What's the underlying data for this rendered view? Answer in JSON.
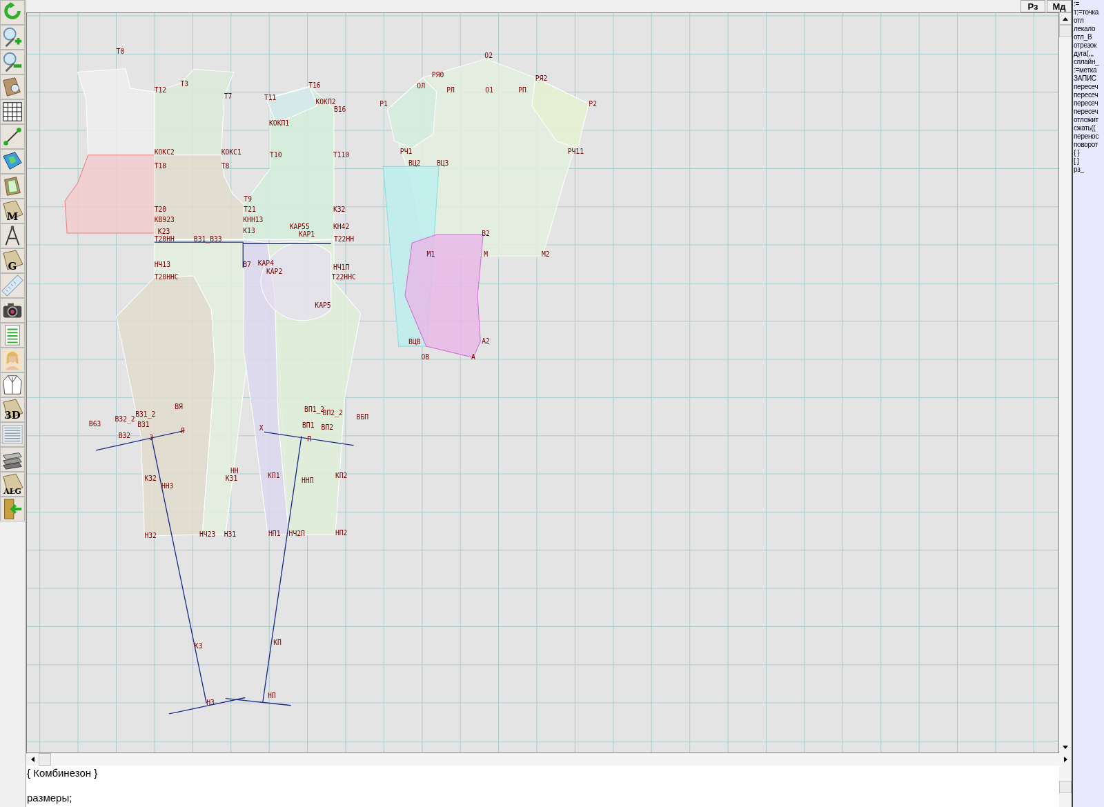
{
  "toolbar": [
    {
      "kind": "refresh"
    },
    {
      "kind": "zoom_in"
    },
    {
      "kind": "zoom_out"
    },
    {
      "kind": "pattern_view"
    },
    {
      "kind": "grid"
    },
    {
      "kind": "segment"
    },
    {
      "kind": "map"
    },
    {
      "kind": "pattern"
    },
    {
      "kind": "lettered",
      "label": "M"
    },
    {
      "kind": "compass"
    },
    {
      "kind": "lettered",
      "label": "G"
    },
    {
      "kind": "ruler"
    },
    {
      "kind": "camera"
    },
    {
      "kind": "sheet"
    },
    {
      "kind": "portrait"
    },
    {
      "kind": "jacket"
    },
    {
      "kind": "lettered",
      "label": "3D"
    },
    {
      "kind": "list"
    },
    {
      "kind": "books"
    },
    {
      "kind": "lettered",
      "label": "ALG"
    },
    {
      "kind": "exit"
    }
  ],
  "top_buttons": [
    "Рз",
    "Мд"
  ],
  "point_labels": [
    "Т0",
    "Т3",
    "Т12",
    "Т7",
    "Т11",
    "Т16",
    "КОКП2",
    "В16",
    "КОКП1",
    "КОКС2",
    "КОКС1",
    "Т10",
    "Т110",
    "Т18",
    "Т8",
    "Т9",
    "Т20",
    "Т21",
    "К32",
    "КВ923",
    "КНН13",
    "КАР55",
    "КН42",
    "К23",
    "К13",
    "КАР1",
    "Т20НН",
    "В31_В33",
    "Т22НН",
    "В7",
    "КАР4",
    "КАР2",
    "НЧ13",
    "НЧ1П",
    "Т20ННС",
    "Т22ННС",
    "КАР5",
    "О2",
    "РЯ0",
    "ОЛ",
    "РЛ",
    "О1",
    "РП",
    "РЯ2",
    "Р1",
    "Р2",
    "РЧ1",
    "РЧ11",
    "ВЦ2",
    "ВЦ3",
    "В2",
    "М1",
    "М",
    "М2",
    "ВЦВ",
    "А2",
    "ОВ",
    "А",
    "ВЯ",
    "В31_2",
    "В32_2",
    "В63",
    "В31",
    "В32",
    "Я",
    "З",
    "ВП1_2",
    "ВП2_2",
    "ВБП",
    "Х",
    "ВП1",
    "ВП2",
    "П",
    "НН",
    "К31",
    "КП1",
    "КП2",
    "К32",
    "НН3",
    "ННП",
    "Н32",
    "НЧ23",
    "Н31",
    "НП1",
    "НЧ2П",
    "НП2",
    "КЗ",
    "КП",
    "НЗ",
    "НП"
  ],
  "commands": [
    ":=",
    "т:=точка",
    "отл",
    "лекало",
    "отл_В",
    "отрезок",
    "дуга(,,,",
    "сплайн_",
    ":=метка",
    "ЗАПИС",
    "пересеч",
    "пересеч",
    "пересеч",
    "пересеч",
    "отложит",
    "сжать((",
    "перенос",
    "поворот",
    "{ }",
    "[ ]",
    "рз_"
  ],
  "editor_lines": [
    "{ Комбинезон }",
    "размеры;"
  ]
}
